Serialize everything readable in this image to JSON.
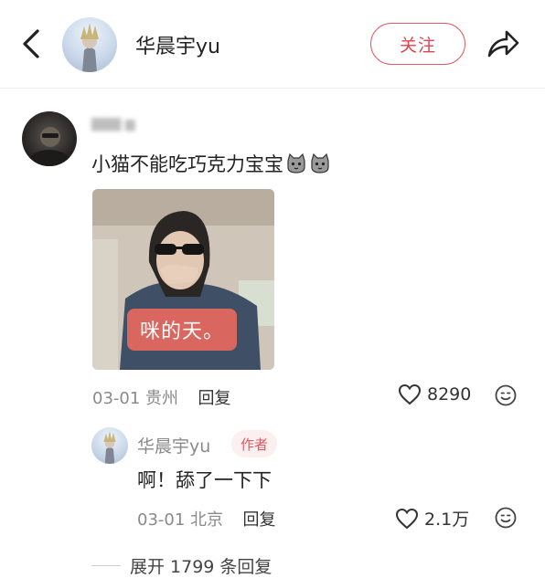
{
  "header": {
    "username": "华晨宇yu",
    "follow_label": "关注"
  },
  "comment": {
    "text": "小猫不能吃巧克力宝宝",
    "sticker_text": "咪的天。",
    "date": "03-01",
    "location": "贵州",
    "reply_label": "回复",
    "likes": "8290"
  },
  "reply": {
    "username": "华晨宇yu",
    "author_badge": "作者",
    "text": "啊！舔了一下下",
    "date": "03-01",
    "location": "北京",
    "reply_label": "回复",
    "likes": "2.1万"
  },
  "expand": {
    "label": "展开 1799 条回复"
  },
  "icons": {
    "back": "chevron-left-icon",
    "share": "share-arrow-icon",
    "like": "heart-outline-icon",
    "emoji": "emoji-face-icon"
  },
  "colors": {
    "accent": "#e0444f",
    "badge_bg": "#fbeff0",
    "sticker_bg": "#d9675f"
  }
}
